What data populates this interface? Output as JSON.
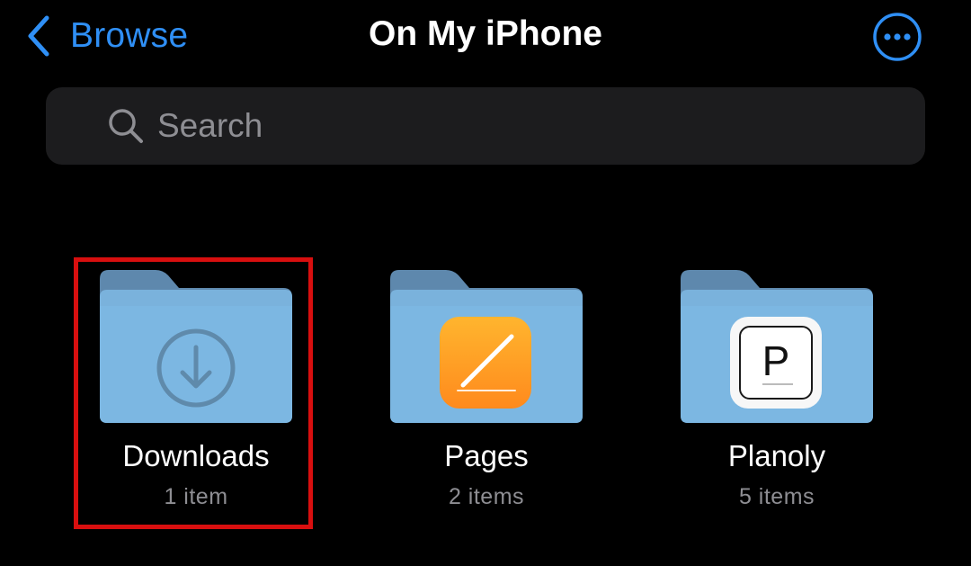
{
  "nav": {
    "back_label": "Browse",
    "title": "On My iPhone",
    "more_icon": "ellipsis-circle-icon",
    "accent_color": "#2f8ff5"
  },
  "search": {
    "placeholder": "Search",
    "value": ""
  },
  "folders": [
    {
      "name": "Downloads",
      "count": "1 item",
      "icon": "download-circle-icon",
      "highlighted": true
    },
    {
      "name": "Pages",
      "count": "2 items",
      "icon": "pages-app-icon",
      "highlighted": false
    },
    {
      "name": "Planoly",
      "count": "5 items",
      "icon": "planoly-app-icon",
      "highlighted": false
    }
  ],
  "highlight_color": "#d80f0f"
}
